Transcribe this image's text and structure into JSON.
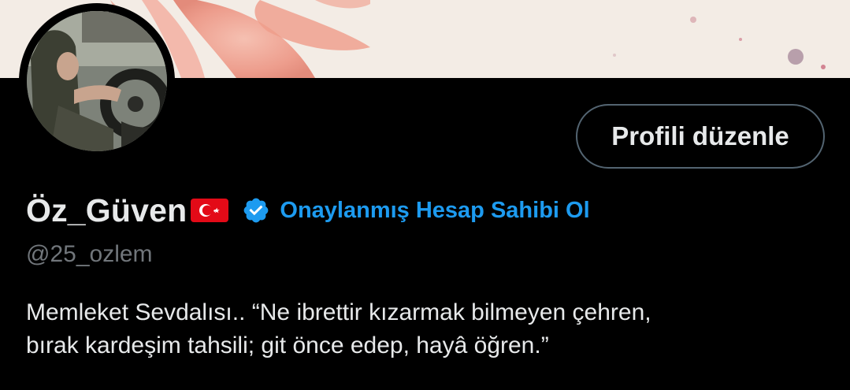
{
  "profile": {
    "display_name": "Öz_Güven",
    "flag_icon": "turkey-flag-icon",
    "verified_icon": "verified-badge-icon",
    "verify_link": "Onaylanmış Hesap Sahibi Ol",
    "handle": "@25_ozlem",
    "bio_lines": [
      "Memleket Sevdalısı..  “Ne ibrettir kızarmak bilmeyen çehren,",
      "bırak kardeşim tahsili; git önce edep, hayâ öğren.”"
    ]
  },
  "actions": {
    "edit_profile_label": "Profili düzenle"
  },
  "colors": {
    "background": "#000000",
    "text": "#e7e9ea",
    "secondary_text": "#71767b",
    "accent": "#1d9bf0",
    "button_border": "#536471"
  }
}
